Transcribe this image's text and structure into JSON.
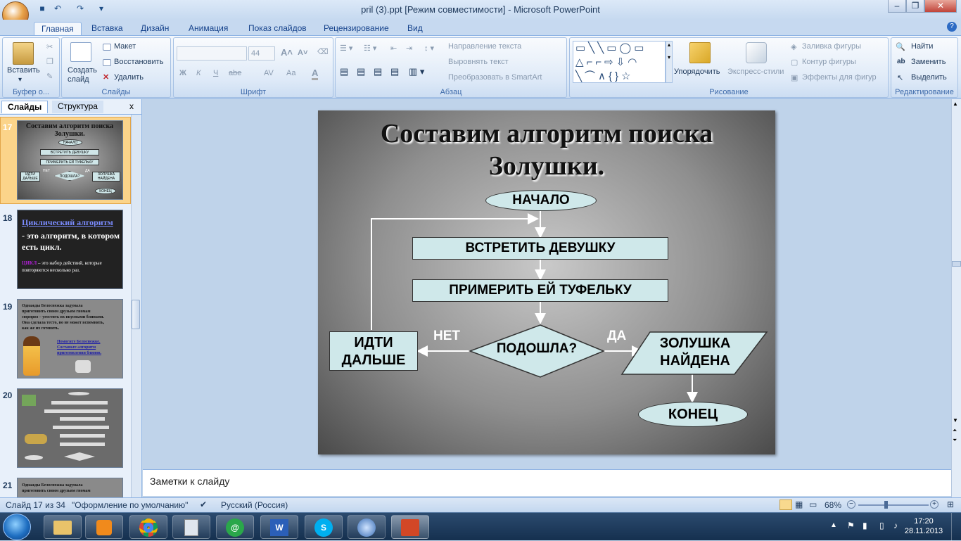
{
  "window": {
    "title": "pril (3).ppt [Режим совместимости] - Microsoft PowerPoint",
    "min": "–",
    "max": "❐",
    "close": "✕"
  },
  "tabs": [
    "Главная",
    "Вставка",
    "Дизайн",
    "Анимация",
    "Показ слайдов",
    "Рецензирование",
    "Вид"
  ],
  "ribbon": {
    "clipboard": {
      "paste": "Вставить",
      "label": "Буфер о..."
    },
    "slides": {
      "new_slide": "Создать слайд",
      "layout": "Макет",
      "reset": "Восстановить",
      "delete": "Удалить",
      "label": "Слайды"
    },
    "font": {
      "size": "44",
      "bold": "Ж",
      "italic": "К",
      "underline": "Ч",
      "strike": "abe",
      "spacing": "AV",
      "case": "Aa",
      "label": "Шрифт"
    },
    "paragraph": {
      "text_direction": "Направление текста",
      "align_text": "Выровнять текст",
      "smartart": "Преобразовать в SmartArt",
      "label": "Абзац"
    },
    "drawing": {
      "arrange": "Упорядочить",
      "quick_styles": "Экспресс-стили",
      "fill": "Заливка фигуры",
      "outline": "Контур фигуры",
      "effects": "Эффекты для фигур",
      "label": "Рисование"
    },
    "editing": {
      "find": "Найти",
      "replace": "Заменить",
      "select": "Выделить",
      "label": "Редактирование"
    }
  },
  "pane": {
    "tab_slides": "Слайды",
    "tab_outline": "Структура",
    "close": "x"
  },
  "thumbs": [
    {
      "num": "17",
      "title": "Составим алгоритм поиска Золушки.",
      "fc": [
        "НАЧАЛО",
        "ВСТРЕТИТЬ ДЕВУШКУ",
        "ПРИМЕРИТЬ ЕЙ ТУФЕЛЬКУ",
        "ПОДОШЛА?",
        "ИДТИ ДАЛЬШЕ",
        "ЗОЛУШКА НАЙДЕНА",
        "КОНЕЦ",
        "НЕТ",
        "ДА"
      ]
    },
    {
      "num": "18",
      "title": "Циклический алгоритм",
      "sub": "- это алгоритм, в котором есть цикл.",
      "word": "ЦИКЛ",
      "def": " – это набор действий, которые повторяются  несколько раз."
    },
    {
      "num": "19",
      "text": "Однажды Белоснежка задумала приготовить своим друзьям гномам сюрприз – угостить их вкусными блинами. Она сделала тесто, но не может вспомнить, как же их готовить.",
      "hint": "Помогите Белоснежке. Составьте алгоритм приготовления блинов."
    },
    {
      "num": "20"
    },
    {
      "num": "21",
      "text": "Однажды Белоснежка задумала приготовить своим друзьям гномам"
    }
  ],
  "slide": {
    "title": "Составим алгоритм поиска Золушки.",
    "start": "НАЧАЛО",
    "step1": "ВСТРЕТИТЬ ДЕВУШКУ",
    "step2": "ПРИМЕРИТЬ ЕЙ ТУФЕЛЬКУ",
    "decision": "ПОДОШЛА?",
    "no_label": "НЕТ",
    "yes_label": "ДА",
    "go_on_1": "ИДТИ",
    "go_on_2": "ДАЛЬШЕ",
    "found_1": "ЗОЛУШКА",
    "found_2": "НАЙДЕНА",
    "end": "КОНЕЦ"
  },
  "notes": {
    "placeholder": "Заметки к слайду"
  },
  "status": {
    "slide": "Слайд 17 из 34",
    "theme": "\"Оформление по умолчанию\"",
    "lang": "Русский (Россия)",
    "zoom": "68%"
  },
  "clock": {
    "time": "17:20",
    "date": "28.11.2013"
  }
}
